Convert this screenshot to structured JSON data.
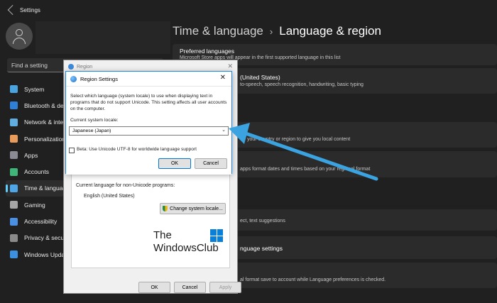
{
  "app": {
    "title": "Settings"
  },
  "search": {
    "placeholder": "Find a setting"
  },
  "nav": [
    {
      "label": "System",
      "icon": "monitor-icon",
      "color": "#4aa3df"
    },
    {
      "label": "Bluetooth & devices",
      "icon": "bluetooth-icon",
      "color": "#2f7fd6"
    },
    {
      "label": "Network & internet",
      "icon": "wifi-icon",
      "color": "#60aee0"
    },
    {
      "label": "Personalization",
      "icon": "brush-icon",
      "color": "#e89b5a"
    },
    {
      "label": "Apps",
      "icon": "apps-icon",
      "color": "#8b8b95"
    },
    {
      "label": "Accounts",
      "icon": "person-icon",
      "color": "#3fb57a"
    },
    {
      "label": "Time & language",
      "icon": "globe-clock-icon",
      "color": "#4ea6e6"
    },
    {
      "label": "Gaming",
      "icon": "gamepad-icon",
      "color": "#a5a5a5"
    },
    {
      "label": "Accessibility",
      "icon": "accessibility-icon",
      "color": "#4a90e2"
    },
    {
      "label": "Privacy & security",
      "icon": "shield-icon",
      "color": "#8a8a8a"
    },
    {
      "label": "Windows Update",
      "icon": "update-icon",
      "color": "#3b91e0"
    }
  ],
  "header": {
    "crumb": "Time & language",
    "title": "Language & region"
  },
  "cards": [
    {
      "title": "Preferred languages",
      "desc": "Microsoft Store apps will appear in the first supported language in this list"
    },
    {
      "title": "(United States)",
      "desc": "to-speech, speech recognition, handwriting, basic typing"
    },
    {
      "title": "",
      "desc": "your country or region to give you local content"
    },
    {
      "title": "",
      "desc": "apps format dates and times based on your regional format"
    },
    {
      "title": "",
      "desc": "ect, text suggestions"
    },
    {
      "title": "nguage settings",
      "desc": ""
    },
    {
      "title": "",
      "desc": "al format save to account while Language preferences is checked."
    }
  ],
  "region_dialog": {
    "title": "Region",
    "non_unicode_label": "Current language for non-Unicode programs:",
    "non_unicode_value": "English (United States)",
    "change_locale_button": "Change system locale...",
    "ok": "OK",
    "cancel": "Cancel",
    "apply": "Apply"
  },
  "region_settings": {
    "title": "Region Settings",
    "intro": "Select which language (system locale) to use when displaying text in programs that do not support Unicode. This setting affects all user accounts on the computer.",
    "locale_label": "Current system locale:",
    "locale_value": "Japanese (Japan)",
    "beta_label": "Beta: Use Unicode UTF-8 for worldwide language support",
    "ok": "OK",
    "cancel": "Cancel"
  },
  "watermark": {
    "line1": "The",
    "line2": "WindowsClub"
  },
  "colors": {
    "accent": "#60cdff",
    "arrow": "#3ba3e0",
    "focus": "#0078d7"
  }
}
